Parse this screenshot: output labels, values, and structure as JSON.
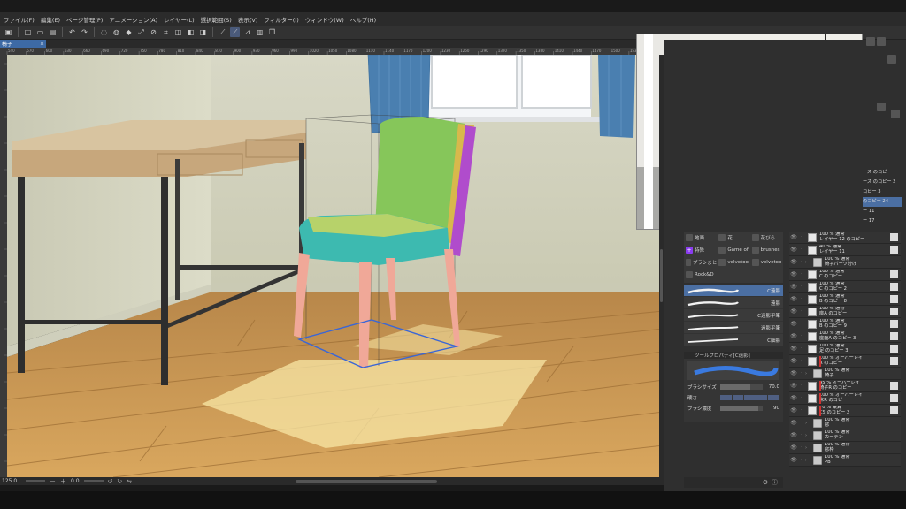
{
  "menu": [
    "ファイル(F)",
    "編集(E)",
    "ページ管理(P)",
    "アニメーション(A)",
    "レイヤー(L)",
    "選択範囲(S)",
    "表示(V)",
    "フィルター(I)",
    "ウィンドウ(W)",
    "ヘルプ(H)"
  ],
  "document_tab": {
    "title": "椅子",
    "close": "×"
  },
  "ruler_top_ticks": [
    "540",
    "570",
    "600",
    "630",
    "660",
    "690",
    "720",
    "750",
    "780",
    "810",
    "840",
    "870",
    "900",
    "930",
    "960",
    "990",
    "1020",
    "1050",
    "1080",
    "1110",
    "1140",
    "1170",
    "1200",
    "1230",
    "1260",
    "1290",
    "1320",
    "1350",
    "1380",
    "1410",
    "1440",
    "1470",
    "1500",
    "1530"
  ],
  "subtool": {
    "rows": [
      [
        {
          "label": "地面",
          "icon": "brush-icon"
        },
        {
          "label": "花",
          "icon": "brush-icon"
        },
        {
          "label": "花びら",
          "icon": "brush-icon"
        }
      ],
      [
        {
          "label": "特殊",
          "icon": "plus-icon",
          "accent": true
        },
        {
          "label": "Game of",
          "icon": "brush-icon"
        },
        {
          "label": "brushes",
          "icon": "brush-icon"
        }
      ],
      [
        {
          "label": "ブラシまと",
          "icon": "brush-icon"
        },
        {
          "label": "velvetoo",
          "icon": "brush-icon"
        },
        {
          "label": "velvetoo",
          "icon": "brush-icon"
        }
      ],
      [
        {
          "label": "Rock&D",
          "icon": "brush-icon"
        },
        {
          "label": "",
          "icon": ""
        },
        {
          "label": "",
          "icon": ""
        }
      ]
    ]
  },
  "brushes": [
    {
      "name": "C遠影",
      "selected": true
    },
    {
      "name": "遠影",
      "selected": false
    },
    {
      "name": "C遠影平筆",
      "selected": false
    },
    {
      "name": "遠影平筆",
      "selected": false
    },
    {
      "name": "C細影",
      "selected": false
    }
  ],
  "tool_property": {
    "header": "ツールプロパティ[C遠影]",
    "brush_size_label": "ブラシサイズ",
    "brush_size_value": "70.0",
    "brush_size_fraction": 0.7,
    "hardness_label": "硬さ",
    "density_label": "ブラシ濃度",
    "density_value": "90",
    "density_fraction": 0.9
  },
  "ref_overlay_labels": [
    "ース のコピー",
    "ース のコピー 2",
    "コピー 3",
    "のコピー 24",
    "ー 11",
    "ー 17"
  ],
  "layers": [
    {
      "label1": "100 % 通常",
      "label2": "レイヤー 12 のコピー",
      "type": "layer",
      "red": false
    },
    {
      "label1": "40 % 通常",
      "label2": "レイヤー 11",
      "type": "layer",
      "red": false
    },
    {
      "label1": "100 % 通常",
      "label2": "椅子パーツ分け",
      "type": "folder",
      "red": false
    },
    {
      "label1": "100 % 通常",
      "label2": "C のコピー",
      "type": "layer",
      "red": false
    },
    {
      "label1": "100 % 通常",
      "label2": "C のコピー 2",
      "type": "layer",
      "red": false
    },
    {
      "label1": "100 % 通常",
      "label2": "B のコピー 8",
      "type": "layer",
      "red": false
    },
    {
      "label1": "100 % 通常",
      "label2": "座A のコピー",
      "type": "layer",
      "red": false
    },
    {
      "label1": "100 % 通常",
      "label2": "B のコピー 9",
      "type": "layer",
      "red": false
    },
    {
      "label1": "100 % 通常",
      "label2": "座面A のコピー 3",
      "type": "layer",
      "red": false
    },
    {
      "label1": "100 % 通常",
      "label2": "足 のコピー 3",
      "type": "layer",
      "red": false
    },
    {
      "label1": "100 % オーバーレイ",
      "label2": "R のコピー",
      "type": "layer",
      "red": true
    },
    {
      "label1": "100 % 通常",
      "label2": "椅子",
      "type": "folder",
      "red": false
    },
    {
      "label1": "45 % オーバーレイ",
      "label2": "椅子R のコピー",
      "type": "layer",
      "red": true
    },
    {
      "label1": "100 % オーバーレイ",
      "label2": "床R のコピー",
      "type": "layer",
      "red": true
    },
    {
      "label1": "70 % 乗算",
      "label2": "CS のコピー 2",
      "type": "layer",
      "red": true
    },
    {
      "label1": "100 % 通常",
      "label2": "窓",
      "type": "folder",
      "red": false
    },
    {
      "label1": "100 % 通常",
      "label2": "カーテン",
      "type": "folder",
      "red": false
    },
    {
      "label1": "100 % 通常",
      "label2": "窓枠",
      "type": "folder",
      "red": false
    },
    {
      "label1": "100 % 通常",
      "label2": "PB",
      "type": "folder",
      "red": false
    }
  ],
  "status": {
    "zoom": "125.0",
    "angle": "0.0"
  },
  "colors": {
    "accent": "#3d6aa5",
    "panel_bg": "#2f2f2f",
    "seat_teal": "#3dbab0",
    "back_green": "#86c65a",
    "side_purple": "#b04ccc",
    "legs_pink": "#f0a898",
    "floor_wood": "#d6a35a",
    "wall": "#d9d8c4"
  }
}
